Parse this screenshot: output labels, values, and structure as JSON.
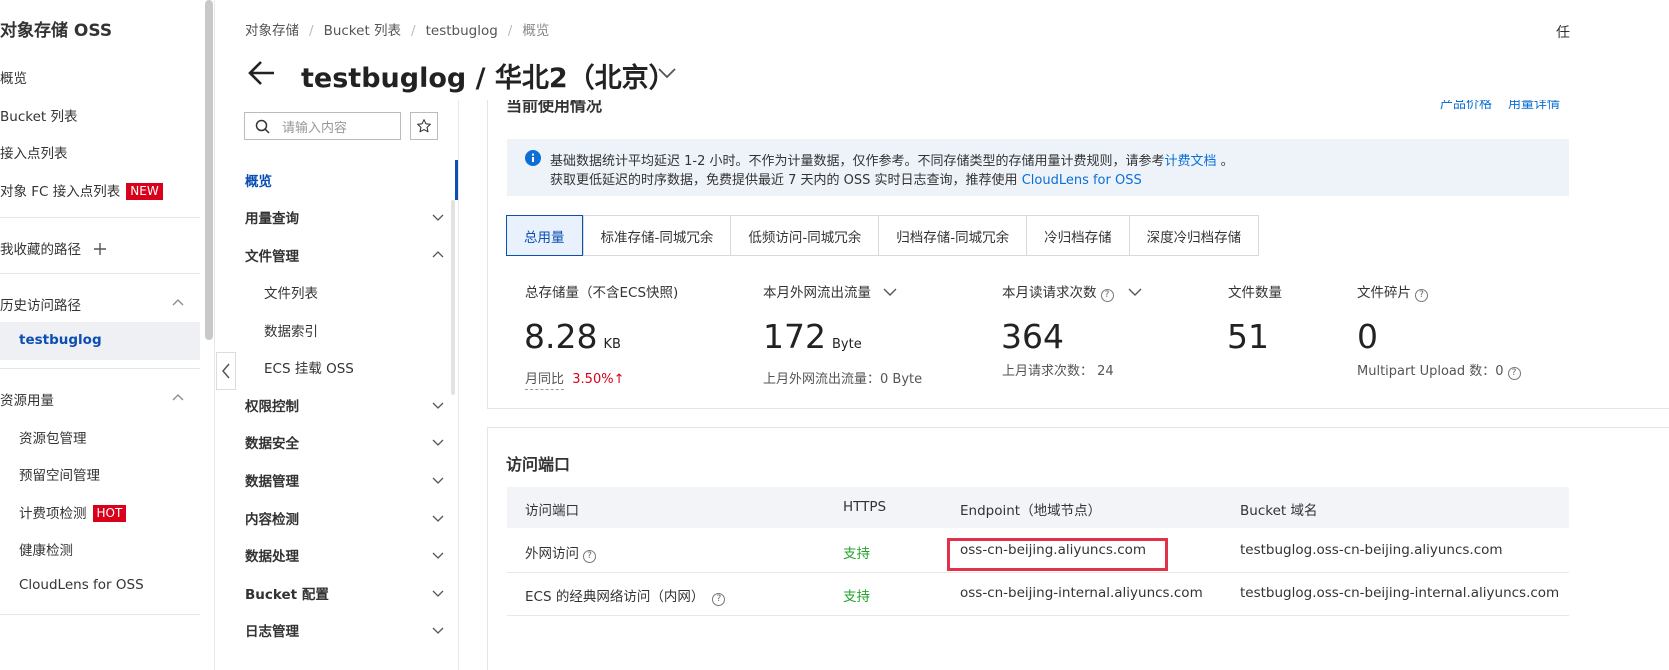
{
  "sidebar": {
    "title": "对象存储 OSS",
    "items": [
      {
        "label": "概览"
      },
      {
        "label": "Bucket 列表"
      },
      {
        "label": "接入点列表"
      },
      {
        "label": "对象 FC 接入点列表",
        "badge": "NEW"
      }
    ],
    "favorites": {
      "label": "我收藏的路径"
    },
    "history": {
      "label": "历史访问路径",
      "items": [
        {
          "label": "testbuglog"
        }
      ]
    },
    "resources": {
      "label": "资源用量",
      "items": [
        {
          "label": "资源包管理"
        },
        {
          "label": "预留空间管理"
        },
        {
          "label": "计费项检测",
          "badge": "HOT"
        },
        {
          "label": "健康检测"
        },
        {
          "label": "CloudLens for OSS"
        }
      ]
    }
  },
  "breadcrumb": [
    "对象存储",
    "Bucket 列表",
    "testbuglog",
    "概览"
  ],
  "header": {
    "title": "testbuglog / 华北2（北京）",
    "corner_text": "任"
  },
  "menu": {
    "search_placeholder": "请输入内容",
    "items": [
      {
        "label": "概览"
      },
      {
        "label": "用量查询"
      },
      {
        "label": "文件管理"
      },
      {
        "label": "文件列表"
      },
      {
        "label": "数据索引"
      },
      {
        "label": "ECS 挂载 OSS"
      },
      {
        "label": "权限控制"
      },
      {
        "label": "数据安全"
      },
      {
        "label": "数据管理"
      },
      {
        "label": "内容检测"
      },
      {
        "label": "数据处理"
      },
      {
        "label": "Bucket 配置"
      },
      {
        "label": "日志管理"
      }
    ]
  },
  "usage": {
    "heading": "当前使用情况",
    "links": [
      "产品价格",
      "用量详情"
    ],
    "info_line1_text": "基础数据统计平均延迟 1-2 小时。不作为计量数据，仅作参考。不同存储类型的存储用量计费规则，请参考",
    "info_line1_link": "计费文档",
    "info_line1_end": "。",
    "info_line2_text": "获取更低延迟的时序数据，免费提供最近 7 天内的 OSS 实时日志查询，推荐使用",
    "info_line2_link": "CloudLens for OSS",
    "tabs": [
      "总用量",
      "标准存储-同城冗余",
      "低频访问-同城冗余",
      "归档存储-同城冗余",
      "冷归档存储",
      "深度冷归档存储"
    ],
    "stats": [
      {
        "label": "总存储量（不含ECS快照)",
        "value": "8.28",
        "unit": "KB",
        "sub_label": "月同比",
        "sub_value": "3.50%",
        "sub_arrow": "↑"
      },
      {
        "label": "本月外网流出流量",
        "value": "172",
        "unit": "Byte",
        "sub": "上月外网流出流量：0 Byte"
      },
      {
        "label": "本月读请求次数",
        "value": "364",
        "sub": "上月请求次数：  24"
      },
      {
        "label": "文件数量",
        "value": "51"
      },
      {
        "label": "文件碎片",
        "value": "0",
        "sub": "Multipart Upload 数：0"
      }
    ]
  },
  "endpoints": {
    "title": "访问端口",
    "headers": [
      "访问端口",
      "HTTPS",
      "Endpoint（地域节点）",
      "Bucket 域名"
    ],
    "rows": [
      {
        "port": "外网访问",
        "https": "支持",
        "endpoint": "oss-cn-beijing.aliyuncs.com",
        "domain": "testbuglog.oss-cn-beijing.aliyuncs.com"
      },
      {
        "port": "ECS 的经典网络访问（内网）",
        "https": "支持",
        "endpoint": "oss-cn-beijing-internal.aliyuncs.com",
        "domain": "testbuglog.oss-cn-beijing-internal.aliyuncs.com"
      }
    ]
  },
  "colors": {
    "accent": "#0b4eb4",
    "link": "#0b6fd6",
    "success": "#22a32a",
    "badge": "#d9001b",
    "highlight": "#e0334a"
  }
}
